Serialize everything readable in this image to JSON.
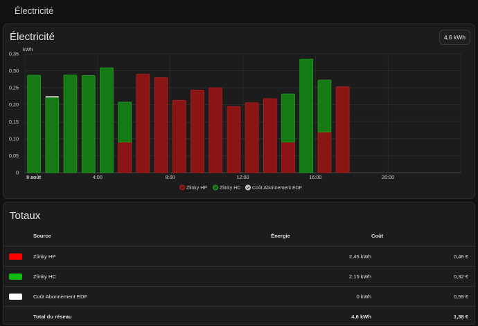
{
  "header": {
    "title": "Électricité"
  },
  "energy_card": {
    "title": "Électricité",
    "total_badge": "4,6 kWh"
  },
  "colors": {
    "hp": "#8b1515",
    "hp_border": "#b12020",
    "hc": "#157a15",
    "hc_border": "#22a022",
    "abonnement": "#ffffff",
    "hp_swatch": "#ff0000",
    "hc_swatch": "#11bb11"
  },
  "chart_data": {
    "type": "bar",
    "stacked": true,
    "ylabel": "kWh",
    "ylim": [
      0,
      0.35
    ],
    "yticks": [
      "0,35",
      "0,30",
      "0,25",
      "0,20",
      "0,15",
      "0,10",
      "0,05",
      "0"
    ],
    "xticks": [
      {
        "label": "9 août",
        "hour": 0
      },
      {
        "label": "4:00",
        "hour": 4
      },
      {
        "label": "8:00",
        "hour": 8
      },
      {
        "label": "12:00",
        "hour": 12
      },
      {
        "label": "16:00",
        "hour": 16
      },
      {
        "label": "20:00",
        "hour": 20
      }
    ],
    "xlim": [
      0,
      24
    ],
    "grid": true,
    "legend_position": "bottom-center",
    "series": [
      {
        "name": "Zlinky HP",
        "values": [
          0,
          0,
          0,
          0,
          0,
          0.09,
          0.29,
          0.28,
          0.213,
          0.243,
          0.25,
          0.195,
          0.206,
          0.218,
          0.09,
          0,
          0.12,
          0.253
        ]
      },
      {
        "name": "Zlinky HC",
        "values": [
          0.287,
          0.222,
          0.288,
          0.286,
          0.309,
          0.118,
          0,
          0,
          0,
          0,
          0,
          0,
          0,
          0,
          0.142,
          0.335,
          0.153,
          0
        ]
      },
      {
        "name": "Coût Abonnement EDF",
        "values": [
          0,
          0.002,
          0,
          0,
          0,
          0,
          0,
          0,
          0,
          0,
          0,
          0,
          0,
          0,
          0,
          0,
          0,
          0
        ]
      }
    ]
  },
  "totals": {
    "title": "Totaux",
    "headers": {
      "source": "Source",
      "energy": "Énergie",
      "cost": "Coût"
    },
    "rows": [
      {
        "source": "Zlinky HP",
        "energy": "2,45 kWh",
        "cost": "0,46 €",
        "color": "#ff0000"
      },
      {
        "source": "Zlinky HC",
        "energy": "2,15 kWh",
        "cost": "0,32 €",
        "color": "#11bb11"
      },
      {
        "source": "Coût Abonnement EDF",
        "energy": "0 kWh",
        "cost": "0,59 €",
        "color": "#ffffff"
      }
    ],
    "total_row": {
      "source": "Total du réseau",
      "energy": "4,6 kWh",
      "cost": "1,38 €"
    }
  }
}
